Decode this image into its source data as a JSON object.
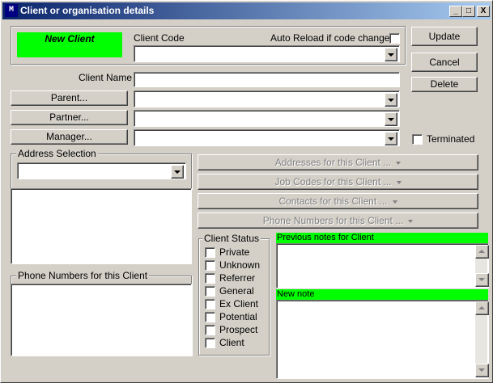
{
  "window": {
    "title": "Client or organisation details",
    "icon_text": "M",
    "minimize_label": "_",
    "maximize_label": "□",
    "close_label": "X"
  },
  "status_badge": "New Client",
  "client_code": {
    "label": "Client Code",
    "value": ""
  },
  "auto_reload_label": "Auto Reload if code changes",
  "client_name": {
    "label": "Client Name",
    "value": ""
  },
  "parent_button": "Parent...",
  "partner_button": "Partner...",
  "manager_button": "Manager...",
  "actions": {
    "update": "Update",
    "cancel": "Cancel",
    "delete": "Delete"
  },
  "terminated_label": "Terminated",
  "address_selection_title": "Address Selection",
  "phone_numbers_group_title": "Phone Numbers for this Client",
  "menu_buttons": {
    "addresses": "Addresses for this Client ...",
    "job_codes": "Job Codes for this Client ...",
    "contacts": "Contacts  for this Client ...",
    "phone_numbers": "Phone Numbers for this Client ..."
  },
  "client_status": {
    "title": "Client Status",
    "options": [
      "Private",
      "Unknown",
      "Referrer",
      "General",
      "Ex Client",
      "Potential",
      "Prospect",
      "Client"
    ]
  },
  "notes": {
    "previous_label": "Previous notes for Client",
    "new_label": "New note"
  },
  "colors": {
    "status_green": "#00ff00",
    "title_bar": "#0a246a",
    "face": "#d4d0c8"
  }
}
